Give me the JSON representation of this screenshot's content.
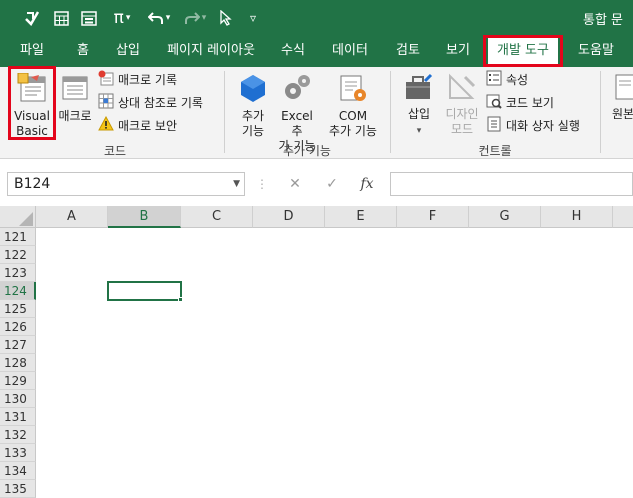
{
  "title_bar": {
    "title": "통합 문",
    "qat": {
      "pi_symbol": "π",
      "dropdown_arrow": "▾",
      "customize_arrow": "▿"
    }
  },
  "tabs": [
    {
      "label": "파일"
    },
    {
      "label": "홈"
    },
    {
      "label": "삽입"
    },
    {
      "label": "페이지 레이아웃"
    },
    {
      "label": "수식"
    },
    {
      "label": "데이터"
    },
    {
      "label": "검토"
    },
    {
      "label": "보기"
    },
    {
      "label": "개발 도구",
      "active": true
    },
    {
      "label": "도움말"
    }
  ],
  "ribbon": {
    "code": {
      "visual_basic": [
        "Visual",
        "Basic"
      ],
      "macros": "매크로",
      "record_macro": "매크로 기록",
      "relative_refs": "상대 참조로 기록",
      "macro_security": "매크로 보안",
      "group_label": "코드"
    },
    "addins": {
      "addins": [
        "추가",
        "기능"
      ],
      "excel_addins": [
        "Excel 추",
        "가 기능"
      ],
      "com_addins": [
        "COM",
        "추가 기능"
      ],
      "group_label": "추가 기능"
    },
    "controls": {
      "insert": "삽입",
      "design_mode": [
        "디자인",
        "모드"
      ],
      "properties": "속성",
      "view_code": "코드 보기",
      "run_dialog": "대화 상자 실행",
      "group_label": "컨트롤"
    },
    "source": {
      "label": "원본"
    }
  },
  "formula_bar": {
    "name_box": "B124",
    "fx_label": "fx",
    "cancel_glyph": "✕",
    "enter_glyph": "✓",
    "formula": ""
  },
  "grid": {
    "columns": [
      "A",
      "B",
      "C",
      "D",
      "E",
      "F",
      "G",
      "H"
    ],
    "rows": [
      "121",
      "122",
      "123",
      "124",
      "125",
      "126",
      "127",
      "128",
      "129",
      "130",
      "131",
      "132",
      "133",
      "134",
      "135"
    ],
    "selected_column": "B",
    "selected_row": "124"
  },
  "highlight_color": "#e3051b",
  "brand_color": "#217346",
  "icons": [
    "save-icon",
    "table-icon",
    "form-icon",
    "pi-icon",
    "undo-icon",
    "redo-icon",
    "pointer-icon",
    "visual-basic-icon",
    "macros-icon",
    "record-macro-icon",
    "relative-reference-icon",
    "warning-icon",
    "addins-icon",
    "gear-icon",
    "com-addins-icon",
    "toolbox-icon",
    "design-mode-icon",
    "properties-icon",
    "view-code-icon",
    "run-dialog-icon",
    "source-icon"
  ]
}
